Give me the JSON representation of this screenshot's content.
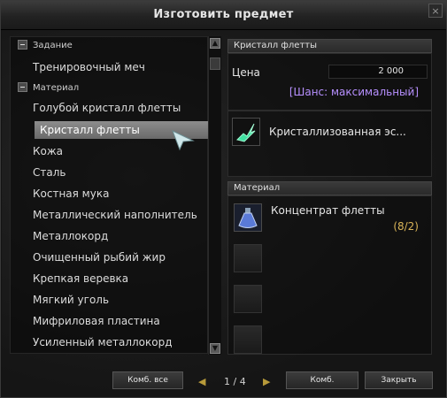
{
  "window": {
    "title": "Изготовить предмет",
    "close_label": "×"
  },
  "tree": {
    "items": [
      {
        "type": "category",
        "label": "Задание"
      },
      {
        "type": "child",
        "label": "Тренировочный меч"
      },
      {
        "type": "category",
        "label": "Материал"
      },
      {
        "type": "child",
        "label": "Голубой кристалл флетты"
      },
      {
        "type": "child",
        "label": "Кристалл флетты",
        "selected": true
      },
      {
        "type": "child",
        "label": "Кожа"
      },
      {
        "type": "child",
        "label": "Сталь"
      },
      {
        "type": "child",
        "label": "Костная мука"
      },
      {
        "type": "child",
        "label": "Металлический наполнитель"
      },
      {
        "type": "child",
        "label": "Металлокорд"
      },
      {
        "type": "child",
        "label": "Очищенный рыбий жир"
      },
      {
        "type": "child",
        "label": "Крепкая веревка"
      },
      {
        "type": "child",
        "label": "Мягкий уголь"
      },
      {
        "type": "child",
        "label": "Мифриловая пластина"
      },
      {
        "type": "child",
        "label": "Усиленный металлокорд"
      }
    ]
  },
  "detail": {
    "item_name": "Кристалл флетты",
    "price_label": "Цена",
    "price_value": "2 000",
    "chance": "[Шанс: максимальный]",
    "result_name": "Кристаллизованная эс...",
    "result_icon": "crystal-icon"
  },
  "materials": {
    "header": "Материал",
    "items": [
      {
        "name": "Концентрат флетты",
        "count": "(8/2)",
        "icon": "potion-icon"
      }
    ]
  },
  "footer": {
    "combine_all": "Комб. все",
    "page": "1 / 4",
    "combine": "Комб.",
    "close": "Закрыть"
  },
  "colors": {
    "chance": "#b790ff",
    "count": "#d9b458",
    "selected_bg": "#7a7a7a",
    "arrow": "#b79a3a"
  }
}
